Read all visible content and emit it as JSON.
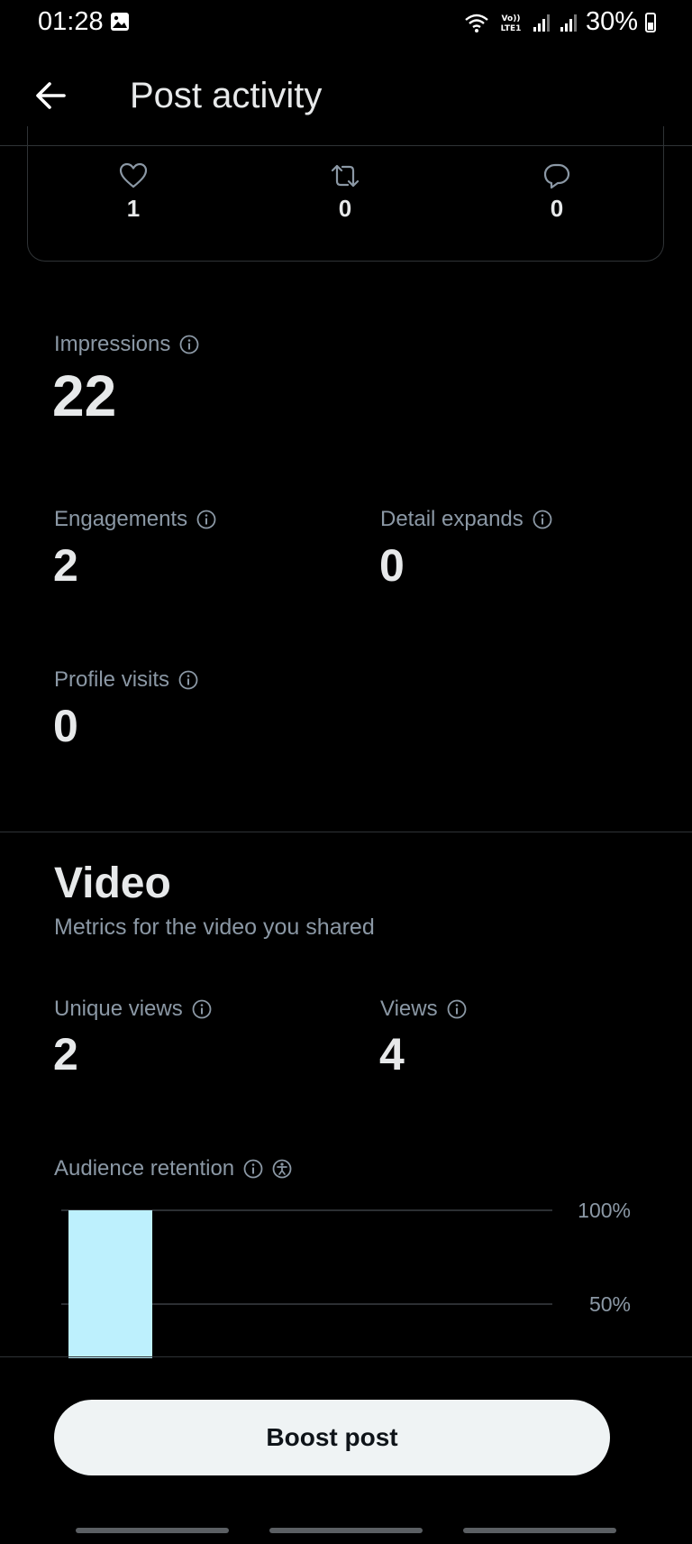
{
  "status_bar": {
    "time": "01:28",
    "battery": "30%",
    "icons": [
      "image-icon",
      "wifi-icon",
      "volte-icon",
      "signal-icon",
      "signal-icon",
      "battery-icon"
    ]
  },
  "header": {
    "title": "Post activity",
    "back_icon": "arrow-left-icon"
  },
  "engagement_counts": {
    "likes": "1",
    "reposts": "0",
    "replies": "0"
  },
  "metrics": {
    "impressions": {
      "label": "Impressions",
      "value": "22"
    },
    "engagements": {
      "label": "Engagements",
      "value": "2"
    },
    "detail_expands": {
      "label": "Detail expands",
      "value": "0"
    },
    "profile_visits": {
      "label": "Profile visits",
      "value": "0"
    }
  },
  "video": {
    "title": "Video",
    "subtitle": "Metrics for the video you shared",
    "unique_views": {
      "label": "Unique views",
      "value": "2"
    },
    "views": {
      "label": "Views",
      "value": "4"
    },
    "retention_label": "Audience retention"
  },
  "chart_data": {
    "type": "bar",
    "title": "",
    "categories": [
      "",
      "",
      ""
    ],
    "values": [
      100,
      0,
      0
    ],
    "y_ticks": [
      "100%",
      "50%"
    ],
    "ylim": [
      0,
      100
    ],
    "grid": true,
    "color": "#bdf0fd"
  },
  "boost_button": {
    "label": "Boost post"
  },
  "colors": {
    "background": "#000000",
    "text_primary": "#e7e9ea",
    "text_secondary": "#8b98a5",
    "divider": "#2f3336",
    "bar": "#bdf0fd"
  }
}
